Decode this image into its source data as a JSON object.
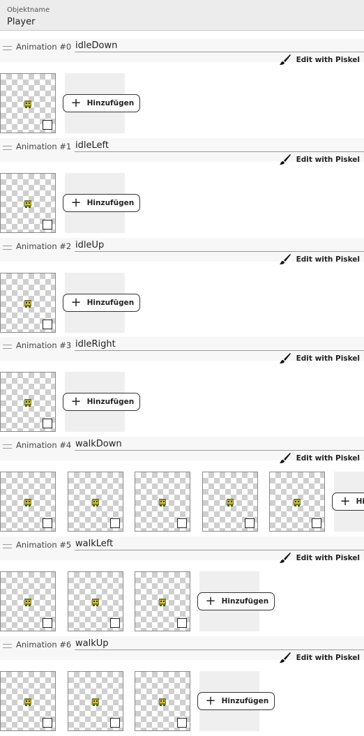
{
  "object": {
    "label": "Objektname",
    "value": "Player"
  },
  "edit_label": "Edit with Piskel",
  "add_label": "Hinzufügen",
  "animations": [
    {
      "label": "Animation #0",
      "name": "idleDown",
      "frames": 1
    },
    {
      "label": "Animation #1",
      "name": "idleLeft",
      "frames": 1
    },
    {
      "label": "Animation #2",
      "name": "idleUp",
      "frames": 1
    },
    {
      "label": "Animation #3",
      "name": "idleRight",
      "frames": 1
    },
    {
      "label": "Animation #4",
      "name": "walkDown",
      "frames": 5
    },
    {
      "label": "Animation #5",
      "name": "walkLeft",
      "frames": 3
    },
    {
      "label": "Animation #6",
      "name": "walkUp",
      "frames": 3
    }
  ],
  "colors": {
    "accent": "#222222",
    "header_bg": "#ececec",
    "sprite_green": "#7a8a2a",
    "sprite_yellow": "#d9c24a"
  }
}
